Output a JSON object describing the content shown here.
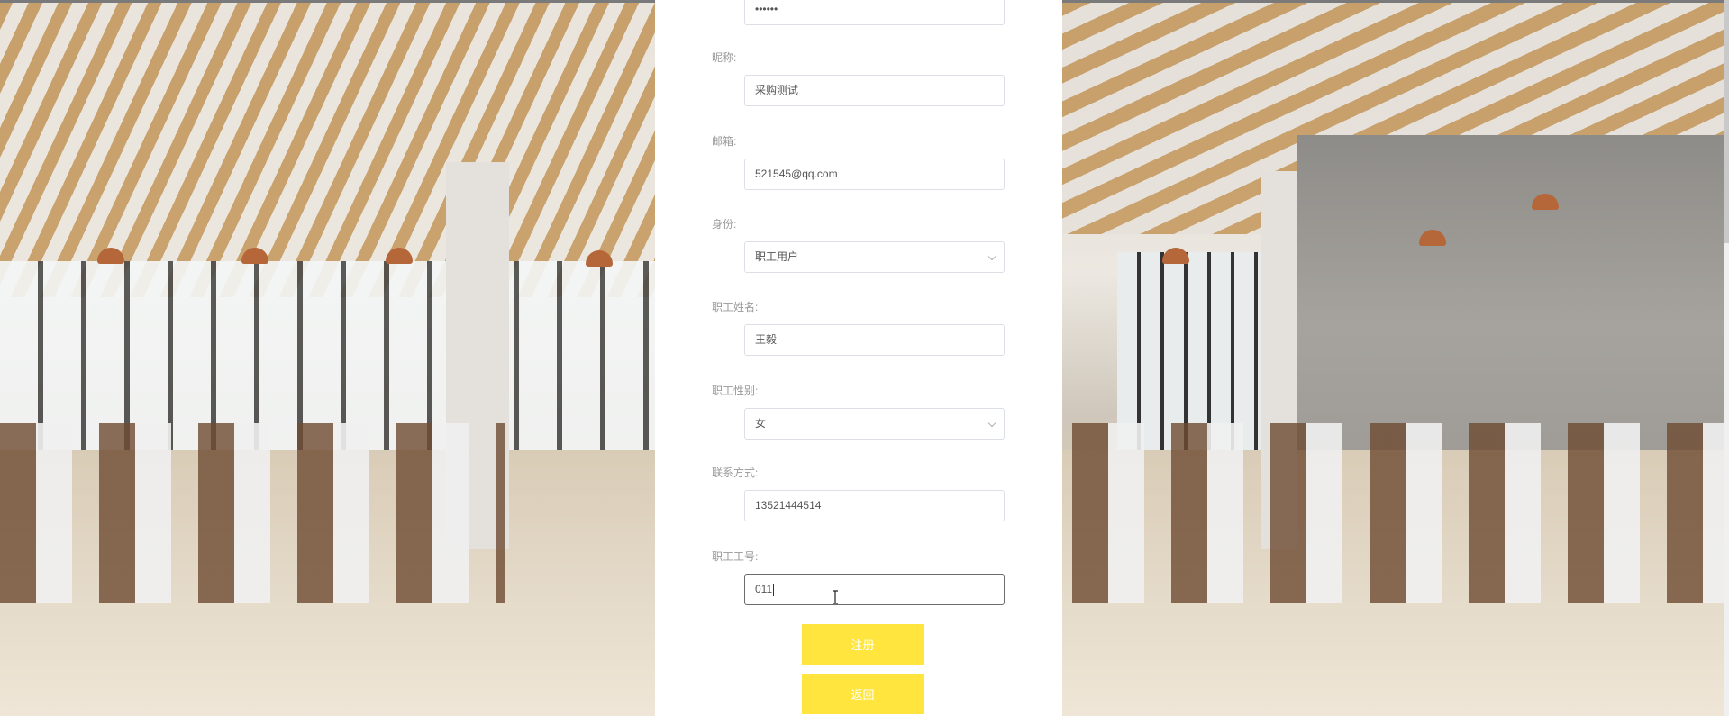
{
  "form": {
    "password": {
      "value": "••••••"
    },
    "nickname": {
      "label": "昵称:",
      "value": "采购测试"
    },
    "email": {
      "label": "邮箱:",
      "value": "521545@qq.com"
    },
    "identity": {
      "label": "身份:",
      "value": "职工用户"
    },
    "staff_name": {
      "label": "职工姓名:",
      "value": "王毅"
    },
    "staff_gender": {
      "label": "职工性别:",
      "value": "女"
    },
    "contact": {
      "label": "联系方式:",
      "value": "13521444514"
    },
    "staff_id": {
      "label": "职工工号:",
      "value": "011"
    }
  },
  "buttons": {
    "register": "注册",
    "back": "返回"
  },
  "colors": {
    "button": "#ffe53d",
    "panel": "#ffffff"
  }
}
